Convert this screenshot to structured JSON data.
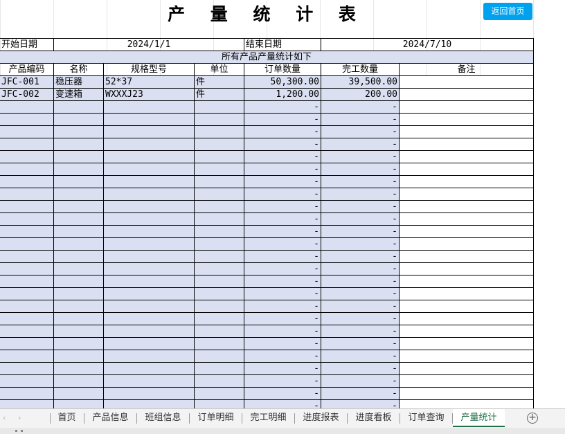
{
  "title": "产 量 统 计 表",
  "home_button": "返回首页",
  "header": {
    "start_label": "开始日期",
    "start_value": "2024/1/1",
    "end_label": "结束日期",
    "end_value": "2024/7/10",
    "banner": "所有产品产量统计如下"
  },
  "columns": [
    "产品编码",
    "名称",
    "规格型号",
    "单位",
    "订单数量",
    "完工数量",
    "备注"
  ],
  "rows": [
    {
      "code": "JFC-001",
      "name": "稳压器",
      "spec": "52*37",
      "unit": "件",
      "order_qty": "50,300.00",
      "done_qty": "39,500.00",
      "note": ""
    },
    {
      "code": "JFC-002",
      "name": "变速箱",
      "spec": "WXXXJ23",
      "unit": "件",
      "order_qty": "1,200.00",
      "done_qty": "200.00",
      "note": ""
    }
  ],
  "empty_row_value": "-",
  "tabs": [
    "首页",
    "产品信息",
    "班组信息",
    "订单明细",
    "完工明细",
    "进度报表",
    "进度看板",
    "订单查询",
    "产量统计"
  ],
  "active_tab": "产量统计",
  "colors": {
    "blue_cell": "#dae0f2",
    "button": "#00a2ef",
    "active_tab": "#1e7145"
  }
}
